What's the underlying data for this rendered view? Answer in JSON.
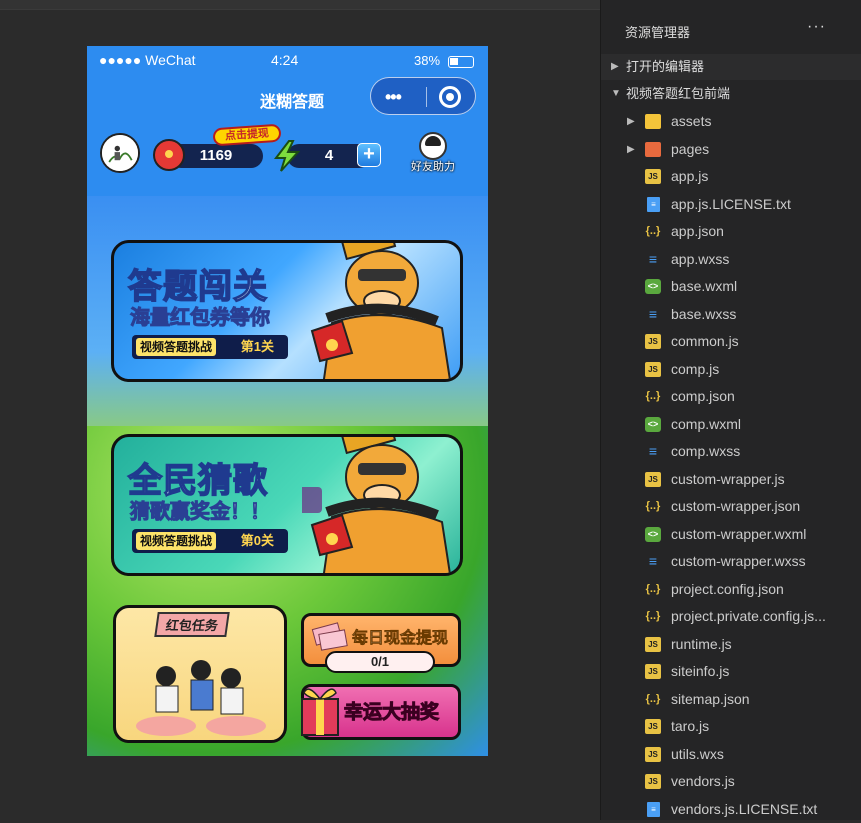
{
  "statusbar": {
    "carrier": "●●●●● WeChat",
    "time": "4:24",
    "battery": "38%"
  },
  "navbar": {
    "title": "迷糊答题",
    "menu_dots": "•••"
  },
  "header": {
    "coins": "1169",
    "cash_tip": "点击提现",
    "energy": "4",
    "plus": "+",
    "friend_help": "好友助力"
  },
  "cards": [
    {
      "title": "答题闯关",
      "subtitle": "海量红包券等你",
      "tag": "视频答题挑战",
      "level": "第1关"
    },
    {
      "title": "全民猜歌",
      "subtitle": "猜歌赢奖金！！",
      "tag": "视频答题挑战",
      "level": "第0关"
    }
  ],
  "tasks": {
    "red_packet_title": "红包任务",
    "daily_cash_title": "每日现金提现",
    "daily_cash_progress": "0/1",
    "lottery_title": "幸运大抽奖"
  },
  "explorer": {
    "header": "资源管理器",
    "more": "···",
    "sections": [
      {
        "label": "打开的编辑器",
        "caret": "▶"
      },
      {
        "label": "视频答题红包前端",
        "caret": "▼"
      }
    ],
    "files": [
      {
        "name": "assets",
        "type": "folder-assets",
        "caret": "▶",
        "icon": ""
      },
      {
        "name": "pages",
        "type": "folder-pages",
        "caret": "▶",
        "icon": ""
      },
      {
        "name": "app.js",
        "type": "js",
        "caret": "",
        "icon": "JS"
      },
      {
        "name": "app.js.LICENSE.txt",
        "type": "txt",
        "caret": "",
        "icon": "≡"
      },
      {
        "name": "app.json",
        "type": "json",
        "caret": "",
        "icon": "{..}"
      },
      {
        "name": "app.wxss",
        "type": "wxss",
        "caret": "",
        "icon": "≡"
      },
      {
        "name": "base.wxml",
        "type": "wxml",
        "caret": "",
        "icon": "<>"
      },
      {
        "name": "base.wxss",
        "type": "wxss",
        "caret": "",
        "icon": "≡"
      },
      {
        "name": "common.js",
        "type": "js",
        "caret": "",
        "icon": "JS"
      },
      {
        "name": "comp.js",
        "type": "js",
        "caret": "",
        "icon": "JS"
      },
      {
        "name": "comp.json",
        "type": "json",
        "caret": "",
        "icon": "{..}"
      },
      {
        "name": "comp.wxml",
        "type": "wxml",
        "caret": "",
        "icon": "<>"
      },
      {
        "name": "comp.wxss",
        "type": "wxss",
        "caret": "",
        "icon": "≡"
      },
      {
        "name": "custom-wrapper.js",
        "type": "js",
        "caret": "",
        "icon": "JS"
      },
      {
        "name": "custom-wrapper.json",
        "type": "json",
        "caret": "",
        "icon": "{..}"
      },
      {
        "name": "custom-wrapper.wxml",
        "type": "wxml",
        "caret": "",
        "icon": "<>"
      },
      {
        "name": "custom-wrapper.wxss",
        "type": "wxss",
        "caret": "",
        "icon": "≡"
      },
      {
        "name": "project.config.json",
        "type": "json",
        "caret": "",
        "icon": "{..}"
      },
      {
        "name": "project.private.config.js...",
        "type": "json",
        "caret": "",
        "icon": "{..}"
      },
      {
        "name": "runtime.js",
        "type": "js",
        "caret": "",
        "icon": "JS"
      },
      {
        "name": "siteinfo.js",
        "type": "js",
        "caret": "",
        "icon": "JS"
      },
      {
        "name": "sitemap.json",
        "type": "json",
        "caret": "",
        "icon": "{..}"
      },
      {
        "name": "taro.js",
        "type": "js",
        "caret": "",
        "icon": "JS"
      },
      {
        "name": "utils.wxs",
        "type": "js",
        "caret": "",
        "icon": "JS"
      },
      {
        "name": "vendors.js",
        "type": "js",
        "caret": "",
        "icon": "JS"
      },
      {
        "name": "vendors.js.LICENSE.txt",
        "type": "txt",
        "caret": "",
        "icon": "≡"
      }
    ]
  }
}
